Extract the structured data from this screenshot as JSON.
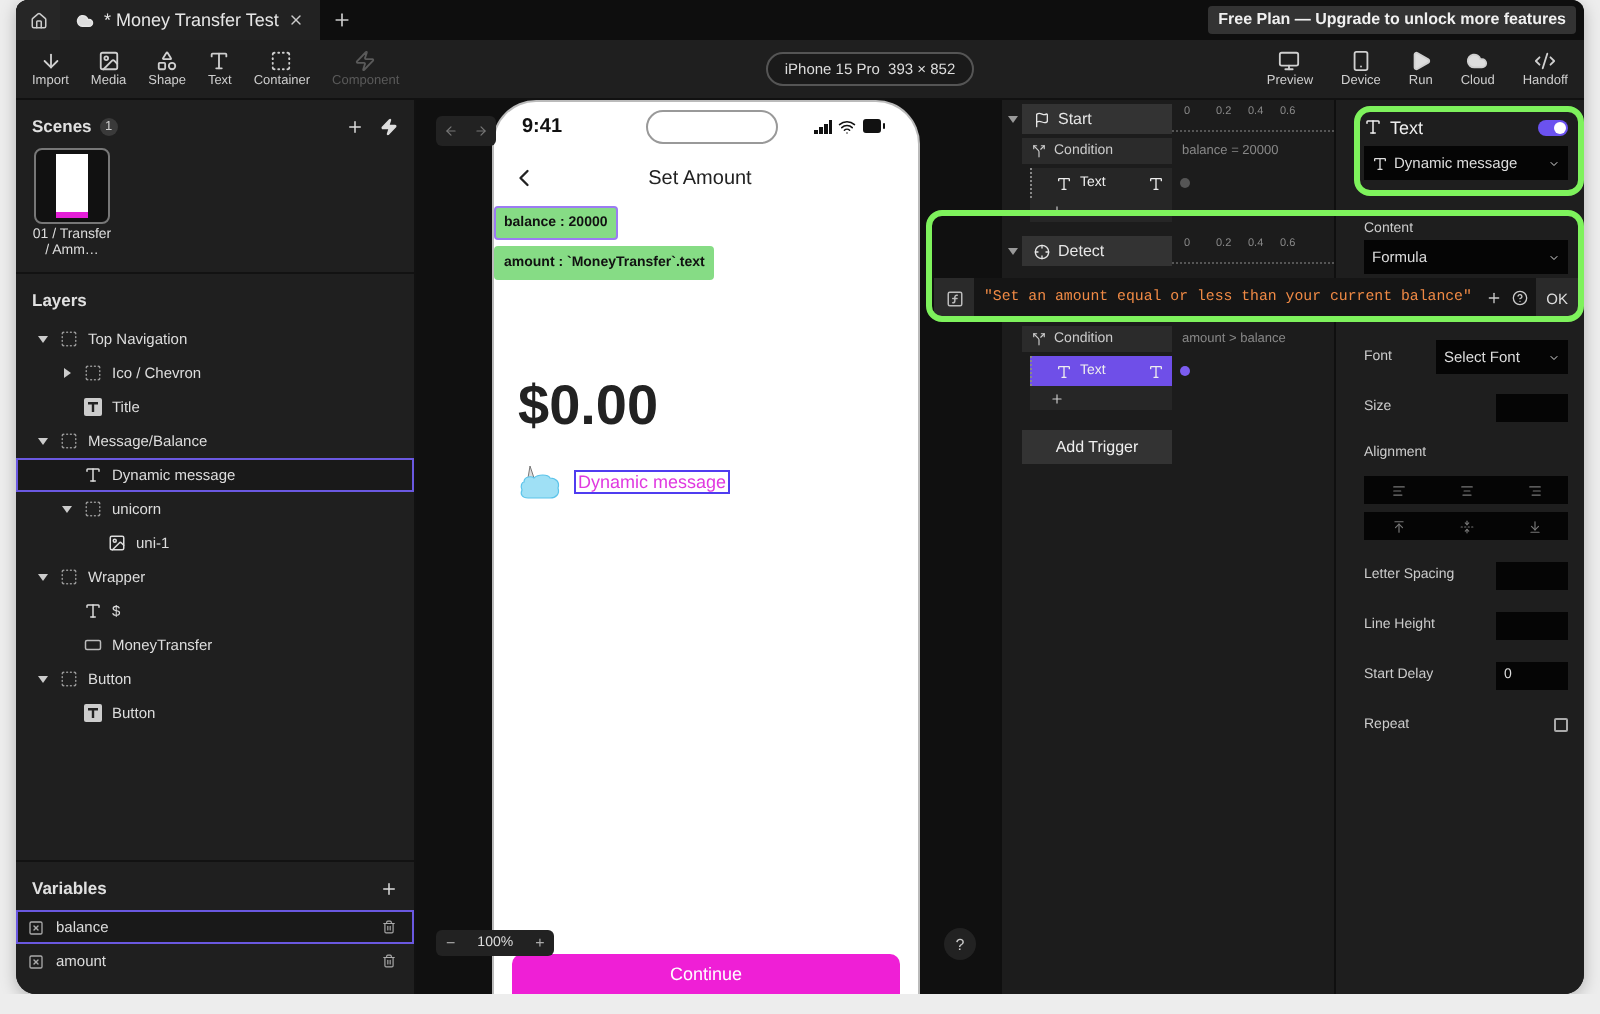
{
  "tabbar": {
    "tab_title": "* Money Transfer Test",
    "plan_banner": "Free Plan — Upgrade to unlock more features"
  },
  "toolbar": {
    "tools": [
      {
        "label": "Import",
        "kind": "import",
        "disabled": false
      },
      {
        "label": "Media",
        "kind": "media",
        "disabled": false
      },
      {
        "label": "Shape",
        "kind": "shape",
        "disabled": false
      },
      {
        "label": "Text",
        "kind": "text",
        "disabled": false
      },
      {
        "label": "Container",
        "kind": "container",
        "disabled": false
      },
      {
        "label": "Component",
        "kind": "component",
        "disabled": true
      }
    ],
    "device": "iPhone 15 Pro  393 × 852",
    "actions": [
      {
        "label": "Preview",
        "kind": "preview"
      },
      {
        "label": "Device",
        "kind": "device"
      },
      {
        "label": "Run",
        "kind": "run"
      },
      {
        "label": "Cloud",
        "kind": "cloud"
      },
      {
        "label": "Handoff",
        "kind": "handoff"
      }
    ]
  },
  "scenes": {
    "title": "Scenes",
    "count": "1",
    "items": [
      {
        "caption": "01 / Transfer / Amm…",
        "selected": true
      }
    ]
  },
  "layers": {
    "title": "Layers",
    "items": [
      {
        "name": "Top Navigation",
        "kind": "group",
        "expanded": true,
        "selected": false,
        "children": [
          {
            "name": "Ico / Chevron",
            "kind": "group",
            "expanded": false,
            "selected": false
          },
          {
            "name": "Title",
            "kind": "textbox",
            "selected": false
          }
        ]
      },
      {
        "name": "Message/Balance",
        "kind": "group",
        "expanded": true,
        "selected": false,
        "children": [
          {
            "name": "Dynamic message",
            "kind": "text",
            "selected": true
          },
          {
            "name": "unicorn",
            "kind": "group",
            "expanded": true,
            "selected": false,
            "children": [
              {
                "name": "uni-1",
                "kind": "image",
                "selected": false
              }
            ]
          }
        ]
      },
      {
        "name": "Wrapper",
        "kind": "group",
        "expanded": true,
        "selected": false,
        "children": [
          {
            "name": "$",
            "kind": "text",
            "selected": false
          },
          {
            "name": "MoneyTransfer",
            "kind": "input",
            "selected": false
          }
        ]
      },
      {
        "name": "Button",
        "kind": "group",
        "expanded": true,
        "selected": false,
        "children": [
          {
            "name": "Button",
            "kind": "textbox",
            "selected": false
          }
        ]
      }
    ]
  },
  "variables": {
    "title": "Variables",
    "items": [
      {
        "name": "balance",
        "selected": true
      },
      {
        "name": "amount",
        "selected": false
      }
    ]
  },
  "canvas": {
    "zoom_out": "−",
    "zoom": "100%",
    "zoom_in": "+",
    "help": "?",
    "phone": {
      "time": "9:41",
      "title": "Set Amount",
      "chips": [
        {
          "label": "balance : 20000",
          "selected": true
        },
        {
          "label": "amount : `MoneyTransfer`.text",
          "selected": false
        }
      ],
      "amount": "$0.00",
      "message": "Dynamic message",
      "button": "Continue"
    }
  },
  "triggers": {
    "items": [
      {
        "label": "Start",
        "kind": "start",
        "expanded": true,
        "ruler": [
          "0",
          "0.2",
          "0.4",
          "0.6"
        ],
        "condition": "Condition",
        "condition_expr": "balance = 20000",
        "actions": [
          {
            "label": "Text",
            "selected": false
          }
        ]
      },
      {
        "label": "Detect",
        "kind": "detect",
        "expanded": true,
        "ruler": [
          "0",
          "0.2",
          "0.4",
          "0.6"
        ],
        "condition": "Condition",
        "condition_expr": "amount > balance",
        "actions": [
          {
            "label": "Text",
            "selected": true
          }
        ]
      }
    ],
    "add_trigger": "Add Trigger"
  },
  "properties": {
    "title": "Text",
    "enabled": true,
    "target": "Dynamic message",
    "content_label": "Content",
    "content_mode": "Formula",
    "fields": [
      {
        "label": "Font",
        "kind": "select",
        "value": "Select Font"
      },
      {
        "label": "Size",
        "kind": "input"
      },
      {
        "label": "Alignment",
        "kind": "alignment"
      },
      {
        "label": "Letter Spacing",
        "kind": "input"
      },
      {
        "label": "Line Height",
        "kind": "input"
      },
      {
        "label": "Start Delay",
        "kind": "input",
        "value": "0"
      },
      {
        "label": "Repeat",
        "kind": "checkbox",
        "checked": false
      }
    ]
  },
  "formula_bar": {
    "value": "\"Set an amount equal or less than your current balance\"",
    "confirm": "OK"
  }
}
